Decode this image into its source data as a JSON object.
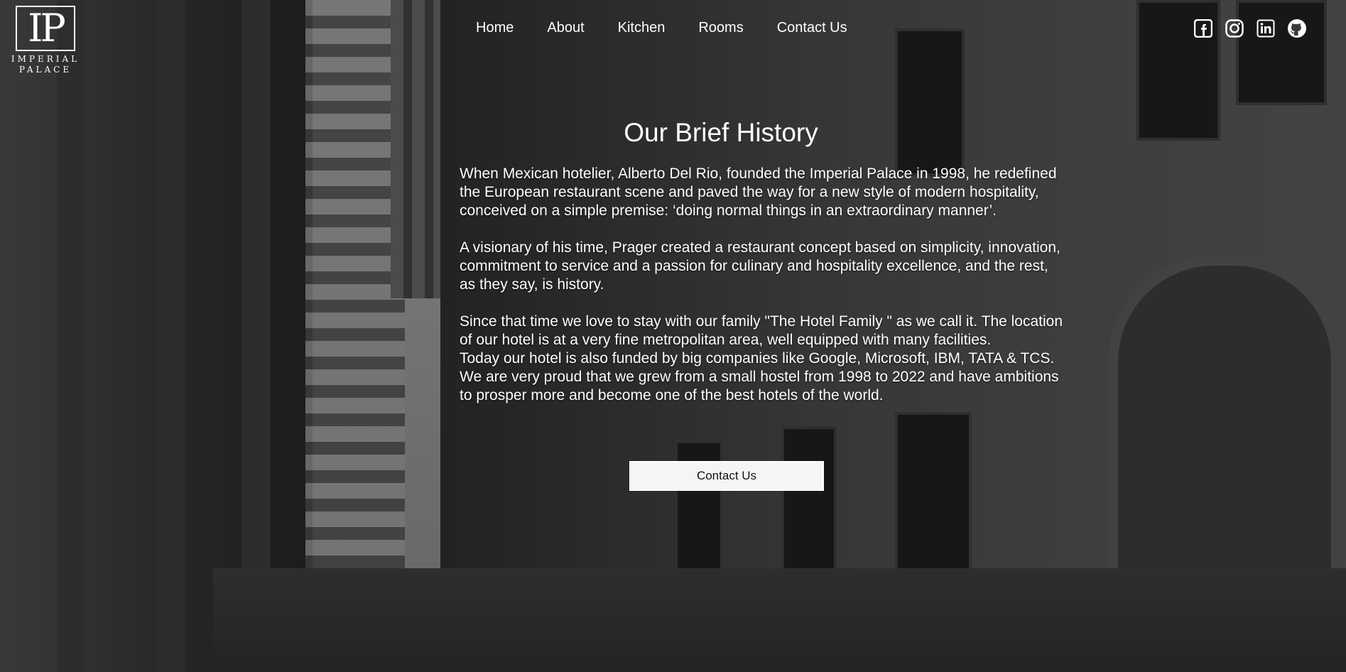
{
  "brand": {
    "monogram": "IP",
    "name_line1": "IMPERIAL",
    "name_line2": "PALACE"
  },
  "nav": [
    {
      "label": "Home"
    },
    {
      "label": "About"
    },
    {
      "label": "Kitchen"
    },
    {
      "label": "Rooms"
    },
    {
      "label": "Contact Us"
    }
  ],
  "social": [
    {
      "icon": "facebook-icon"
    },
    {
      "icon": "instagram-icon"
    },
    {
      "icon": "linkedin-icon"
    },
    {
      "icon": "github-icon"
    }
  ],
  "history": {
    "title": "Our Brief History",
    "paragraphs": [
      "When Mexican hotelier, Alberto Del Rio, founded the Imperial Palace in 1998, he redefined the European restaurant scene and paved the way for a new style of modern hospitality, conceived on a simple premise: ‘doing normal things in an extraordinary manner’.",
      "A visionary of his time, Prager created a restaurant concept based on simplicity, innovation, commitment to service and a passion for culinary and hospitality excellence, and the rest, as they say, is history.",
      "Since that time we love to stay with our family \"The Hotel Family \" as we call it. The location of our hotel is at a very fine metropolitan area, well equipped with many facilities.",
      "Today our hotel is also funded by big companies like Google, Microsoft, IBM, TATA & TCS. We are very proud that we grew from a small hostel from 1998 to 2022 and have ambitions to prosper more and become one of the best hotels of the world."
    ],
    "button_label": "Contact Us"
  },
  "colors": {
    "text": "#ffffff",
    "button_bg": "#f5f5f5",
    "button_text": "#111111"
  }
}
